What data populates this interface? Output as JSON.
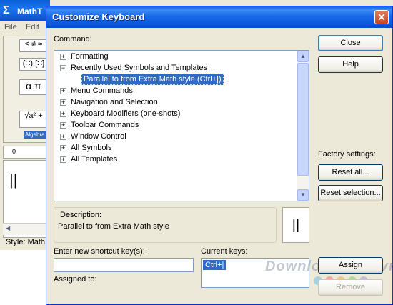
{
  "background_app": {
    "title": "MathT",
    "menu": [
      "File",
      "Edit"
    ],
    "palette_row1": "≤ ≠ ≈",
    "palette_row2": "(∷) [∷]",
    "palette_row3": "α π",
    "palette_tab": "Algebra",
    "palette_row4": "√a² +",
    "ruler": "0",
    "status": "Style: Math"
  },
  "dialog": {
    "title": "Customize Keyboard",
    "command_label": "Command:",
    "tree": [
      {
        "label": "Formatting",
        "expander": "+"
      },
      {
        "label": "Recently Used Symbols and Templates",
        "expander": "−"
      },
      {
        "label": "Parallel to from Extra Math style (Ctrl+|)",
        "child": true,
        "selected": true
      },
      {
        "label": "Menu Commands",
        "expander": "+"
      },
      {
        "label": "Navigation and Selection",
        "expander": "+"
      },
      {
        "label": "Keyboard Modifiers (one-shots)",
        "expander": "+"
      },
      {
        "label": "Toolbar Commands",
        "expander": "+"
      },
      {
        "label": "Window Control",
        "expander": "+"
      },
      {
        "label": "All Symbols",
        "expander": "+"
      },
      {
        "label": "All Templates",
        "expander": "+"
      }
    ],
    "description_label": "Description:",
    "description_text": "Parallel to from Extra Math style",
    "preview_symbol": "||",
    "new_shortcut_label": "Enter new shortcut key(s):",
    "new_shortcut_value": "",
    "assigned_to_label": "Assigned to:",
    "current_keys_label": "Current keys:",
    "current_keys": [
      "Ctrl+|"
    ],
    "buttons": {
      "close": "Close",
      "help": "Help",
      "reset_all": "Reset all...",
      "reset_selection": "Reset selection...",
      "assign": "Assign",
      "remove": "Remove"
    },
    "factory_settings_label": "Factory settings:",
    "watermark": "Download.com.vn"
  },
  "colors": {
    "title_bar": "#0a5fd8",
    "selection": "#316ac5",
    "dialog_bg": "#ece9d8",
    "close_button": "#c9421f"
  }
}
